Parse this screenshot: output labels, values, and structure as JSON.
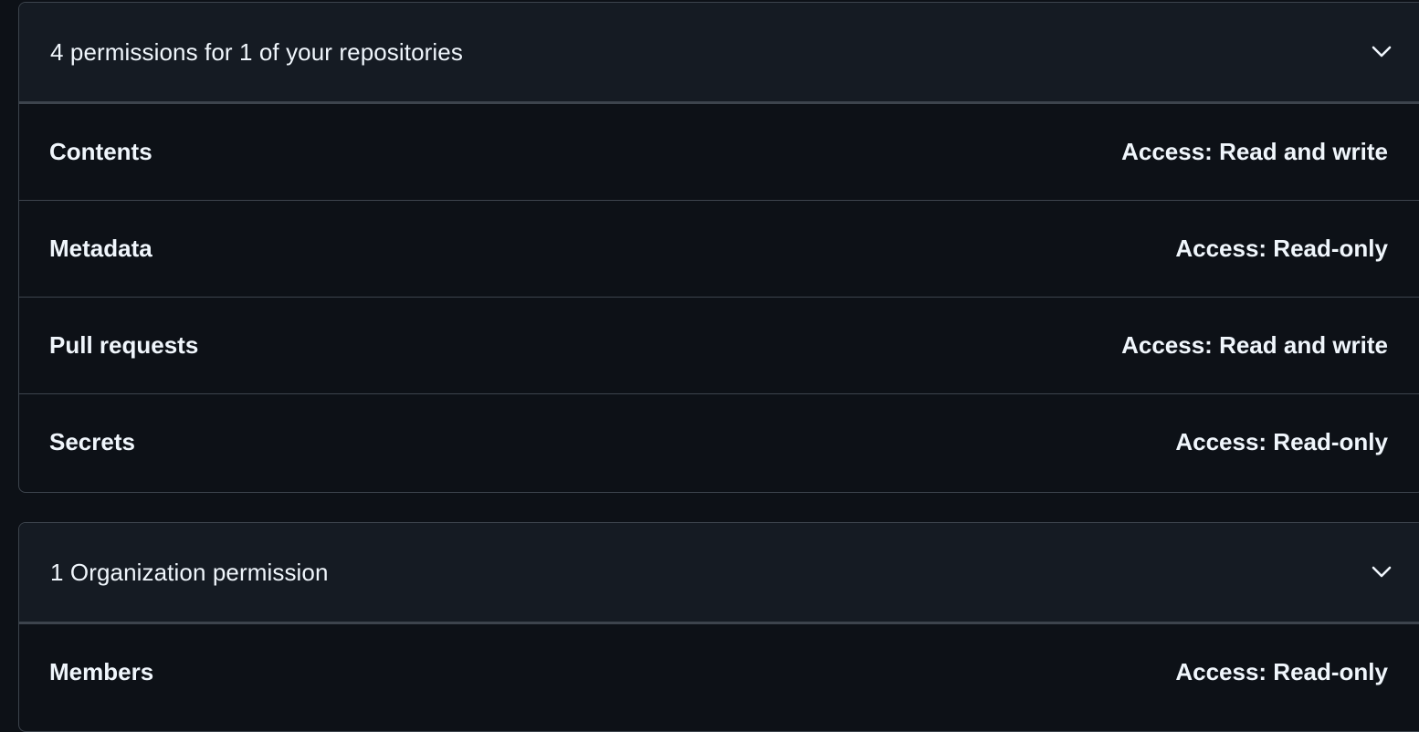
{
  "repo_section": {
    "title": "4 permissions for 1 of your repositories",
    "expand_icon": "chevron-down-icon",
    "permissions": [
      {
        "name": "Contents",
        "access": "Access: Read and write"
      },
      {
        "name": "Metadata",
        "access": "Access: Read-only"
      },
      {
        "name": "Pull requests",
        "access": "Access: Read and write"
      },
      {
        "name": "Secrets",
        "access": "Access: Read-only"
      }
    ]
  },
  "org_section": {
    "title": "1 Organization permission",
    "expand_icon": "chevron-down-icon",
    "permissions": [
      {
        "name": "Members",
        "access": "Access: Read-only"
      }
    ]
  },
  "colors": {
    "background": "#0d1117",
    "header_background": "#151b23",
    "border": "#3d444d",
    "text": "#f0f6fc"
  }
}
